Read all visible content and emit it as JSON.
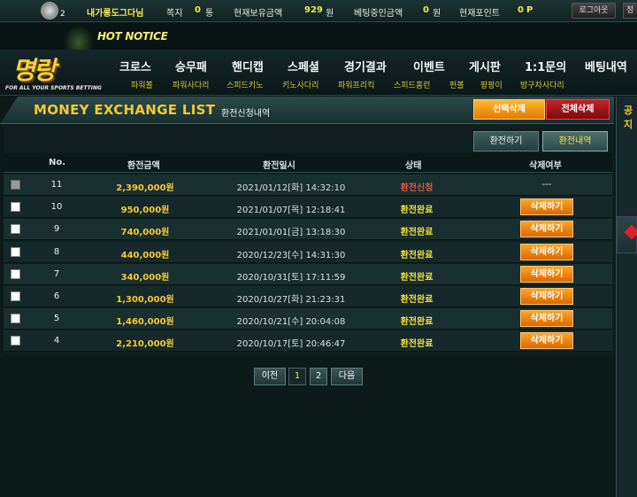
{
  "topbar": {
    "level": "2",
    "nickname": "내가롱도그다님",
    "mail_label": "쪽지",
    "mail_count": "0",
    "mail_unit": "통",
    "balance_label": "현재보유금액",
    "balance": "929",
    "balance_unit": "원",
    "betting_label": "베팅중인금액",
    "betting": "0",
    "betting_unit": "원",
    "points_label": "현재포인트",
    "points": "0",
    "points_unit": "P",
    "logout": "로그아웃",
    "extra": "정"
  },
  "notice": {
    "label": "HOT NOTICE"
  },
  "logo": {
    "text": "명랑",
    "slogan": "FOR ALL YOUR SPORTS BETTING"
  },
  "nav": {
    "main": [
      "크로스",
      "승무패",
      "핸디캡",
      "스페셜",
      "경기결과",
      "이벤트",
      "게시판",
      "1:1문의",
      "베팅내역"
    ],
    "sub": [
      "파워볼",
      "파워사다리",
      "스피드키노",
      "키노사다리",
      "파워프리킥",
      "스피드홈런",
      "펀볼",
      "팡팡이",
      "방구차사다리"
    ]
  },
  "page": {
    "title_en": "MONEY EXCHANGE LIST",
    "title_kr": "환전신청내역",
    "btn_select_delete": "선택삭제",
    "btn_all_delete": "전체삭제",
    "tab_exchange": "환전하기",
    "tab_history": "환전내역"
  },
  "side": {
    "title": "공지"
  },
  "table": {
    "headers": [
      "No.",
      "환전금액",
      "환전일시",
      "상태",
      "삭제여부"
    ],
    "rows": [
      {
        "no": "11",
        "amount": "2,390,000원",
        "date": "2021/01/12[화] 14:32:10",
        "status": "환전신청",
        "status_color": "#e8553a",
        "action": "---",
        "disabled": true
      },
      {
        "no": "10",
        "amount": "950,000원",
        "date": "2021/01/07[목] 12:18:41",
        "status": "환전완료",
        "status_color": "#f5e23a",
        "action": "삭제하기",
        "disabled": false
      },
      {
        "no": "9",
        "amount": "740,000원",
        "date": "2021/01/01[금] 13:18:30",
        "status": "환전완료",
        "status_color": "#f5e23a",
        "action": "삭제하기",
        "disabled": false
      },
      {
        "no": "8",
        "amount": "440,000원",
        "date": "2020/12/23[수] 14:31:30",
        "status": "환전완료",
        "status_color": "#f5e23a",
        "action": "삭제하기",
        "disabled": false
      },
      {
        "no": "7",
        "amount": "340,000원",
        "date": "2020/10/31[토] 17:11:59",
        "status": "환전완료",
        "status_color": "#f5e23a",
        "action": "삭제하기",
        "disabled": false
      },
      {
        "no": "6",
        "amount": "1,300,000원",
        "date": "2020/10/27[화] 21:23:31",
        "status": "환전완료",
        "status_color": "#f5e23a",
        "action": "삭제하기",
        "disabled": false
      },
      {
        "no": "5",
        "amount": "1,460,000원",
        "date": "2020/10/21[수] 20:04:08",
        "status": "환전완료",
        "status_color": "#f5e23a",
        "action": "삭제하기",
        "disabled": false
      },
      {
        "no": "4",
        "amount": "2,210,000원",
        "date": "2020/10/17[토] 20:46:47",
        "status": "환전완료",
        "status_color": "#f5e23a",
        "action": "삭제하기",
        "disabled": false
      }
    ]
  },
  "pagination": {
    "prev": "이전",
    "pages": [
      "1",
      "2"
    ],
    "current": "1",
    "next": "다음"
  },
  "colors": {
    "accent_yellow": "#f5c932",
    "orange": "#e07b00",
    "red": "#c42327",
    "bg": "#0d1a1a"
  }
}
